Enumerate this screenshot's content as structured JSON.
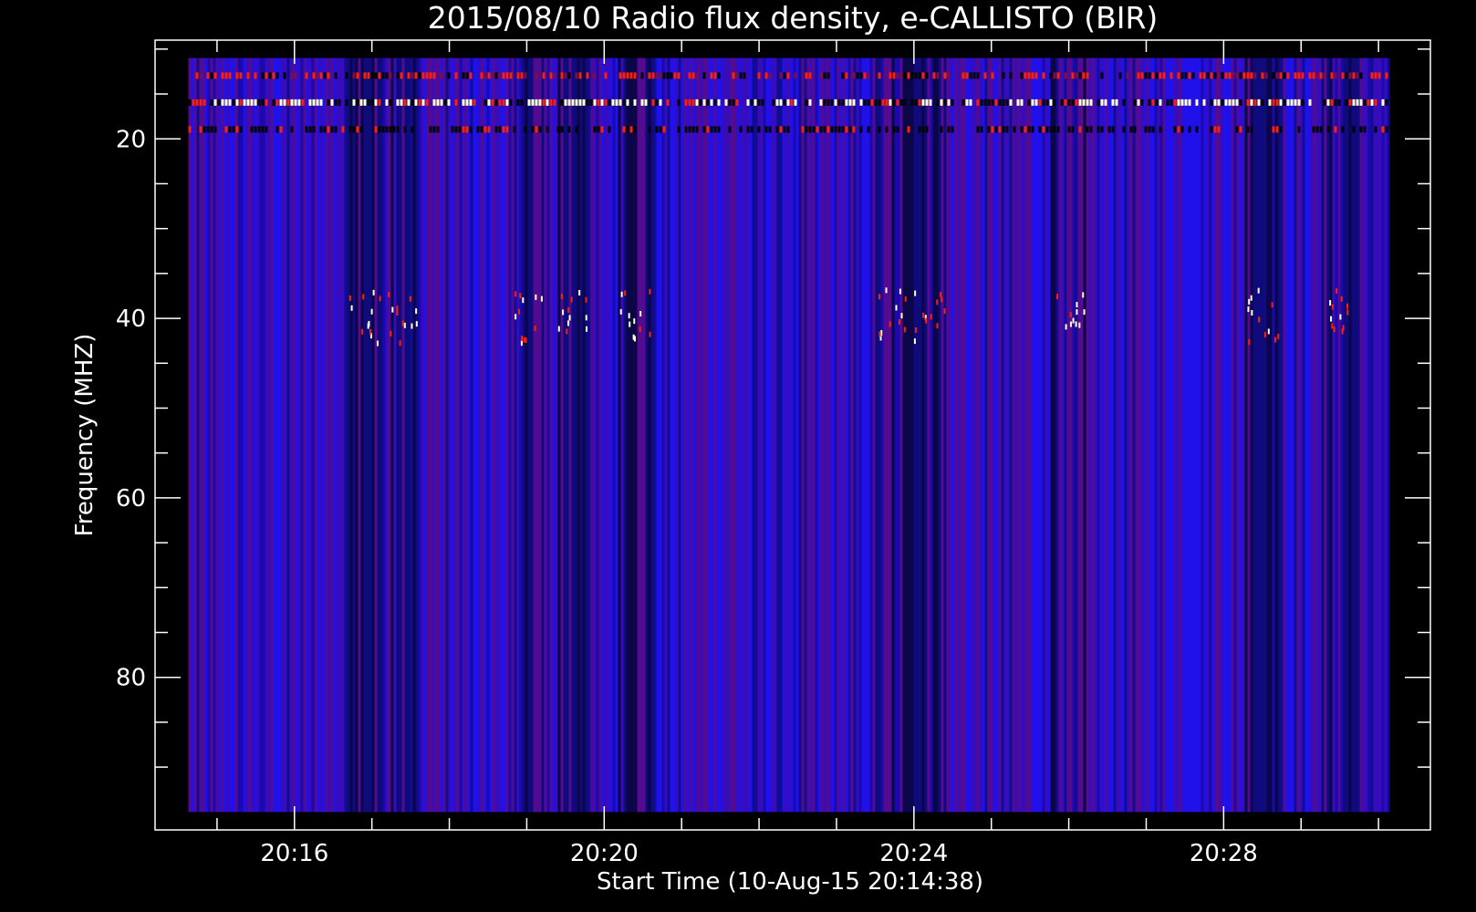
{
  "chart_data": {
    "type": "heatmap",
    "title": "2015/08/10  Radio flux density, e-CALLISTO (BIR)",
    "xlabel": "Start Time (10-Aug-15 20:14:38)",
    "ylabel": "Frequency (MHZ)",
    "x_start_minutes": 14.63,
    "x_end_minutes": 30.12,
    "xlim_minutes": [
      14.2,
      30.67
    ],
    "x_tick_labels": [
      "20:16",
      "20:20",
      "20:24",
      "20:28"
    ],
    "x_tick_values_minutes": [
      16,
      20,
      24,
      28
    ],
    "x_minor_tick_values_minutes": [
      15,
      17,
      18,
      19,
      21,
      22,
      23,
      25,
      26,
      27,
      29,
      30
    ],
    "y_tick_labels": [
      "20",
      "40",
      "60",
      "80"
    ],
    "y_tick_values": [
      20,
      40,
      60,
      80
    ],
    "y_minor_tick_values": [
      10,
      15,
      25,
      30,
      35,
      45,
      50,
      55,
      65,
      70,
      75,
      85,
      90
    ],
    "ylim": [
      9,
      97
    ],
    "y_inverted": true,
    "freq_range": [
      11,
      95
    ],
    "colormap": [
      "#000000",
      "#0000ff",
      "#7a0e4a",
      "#ff2000",
      "#ffffd8"
    ],
    "interference_bands_mhz": [
      13,
      16,
      19
    ],
    "burst_row_mhz": [
      38,
      41
    ],
    "active_column_minutes": [
      16.9,
      17.4,
      19.0,
      19.6,
      20.4,
      23.7,
      24.2,
      26.0,
      28.5,
      29.5
    ]
  }
}
